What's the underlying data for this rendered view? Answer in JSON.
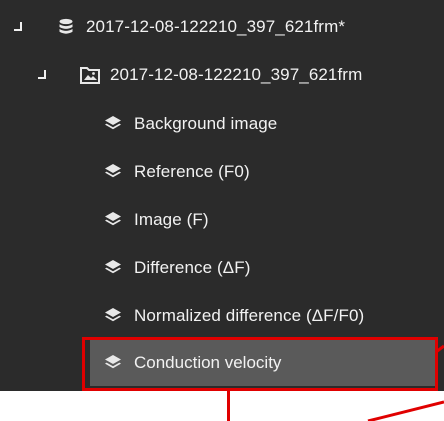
{
  "tree": {
    "root": {
      "label": "2017-12-08-122210_397_621frm*",
      "icon": "database-icon",
      "expander_icon": "collapse-icon"
    },
    "file": {
      "label": "2017-12-08-122210_397_621frm",
      "icon": "image-folder-icon",
      "expander_icon": "collapse-icon"
    },
    "layers": [
      {
        "label": "Background image",
        "icon": "layers-icon"
      },
      {
        "label": "Reference (F0)",
        "icon": "layers-icon"
      },
      {
        "label": "Image (F)",
        "icon": "layers-icon"
      },
      {
        "label": "Difference (ΔF)",
        "icon": "layers-icon"
      },
      {
        "label": "Normalized difference (ΔF/F0)",
        "icon": "layers-icon"
      }
    ],
    "selected_layer": {
      "label": "Conduction velocity",
      "icon": "layers-icon"
    }
  },
  "colors": {
    "panel_background": "#2b2b2b",
    "selected_background": "#5a5a5a",
    "text": "#f2f2f2",
    "annotation": "#e00000"
  }
}
